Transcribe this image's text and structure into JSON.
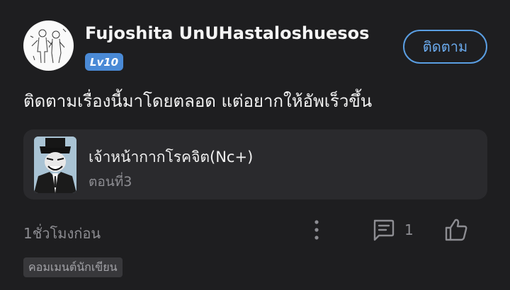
{
  "comment": {
    "username": "Fujoshita UnUHastaloshuesos",
    "level": "Lv10",
    "follow_label": "ติดตาม",
    "text": "ติดตามเรื่องนี้มาโดยตลอด แต่อยากให้อัพเร็วขึ้น",
    "time": "1ชั่วโมงก่อน",
    "reply_count": "1",
    "author_tag": "คอมเมนต์นักเขียน"
  },
  "series": {
    "title": "เจ้าหน้ากากโรคจิต(Nc+)",
    "episode": "ตอนที่3"
  },
  "icons": {
    "avatar": "avatar-illustration",
    "more": "more-vertical-icon",
    "comment": "comment-icon",
    "like": "thumbs-up-icon"
  },
  "colors": {
    "background": "#1e1e20",
    "accent": "#5a9ee2",
    "badge": "#4a8ad6",
    "card": "#2a2a2d",
    "muted": "#8d8d92"
  }
}
